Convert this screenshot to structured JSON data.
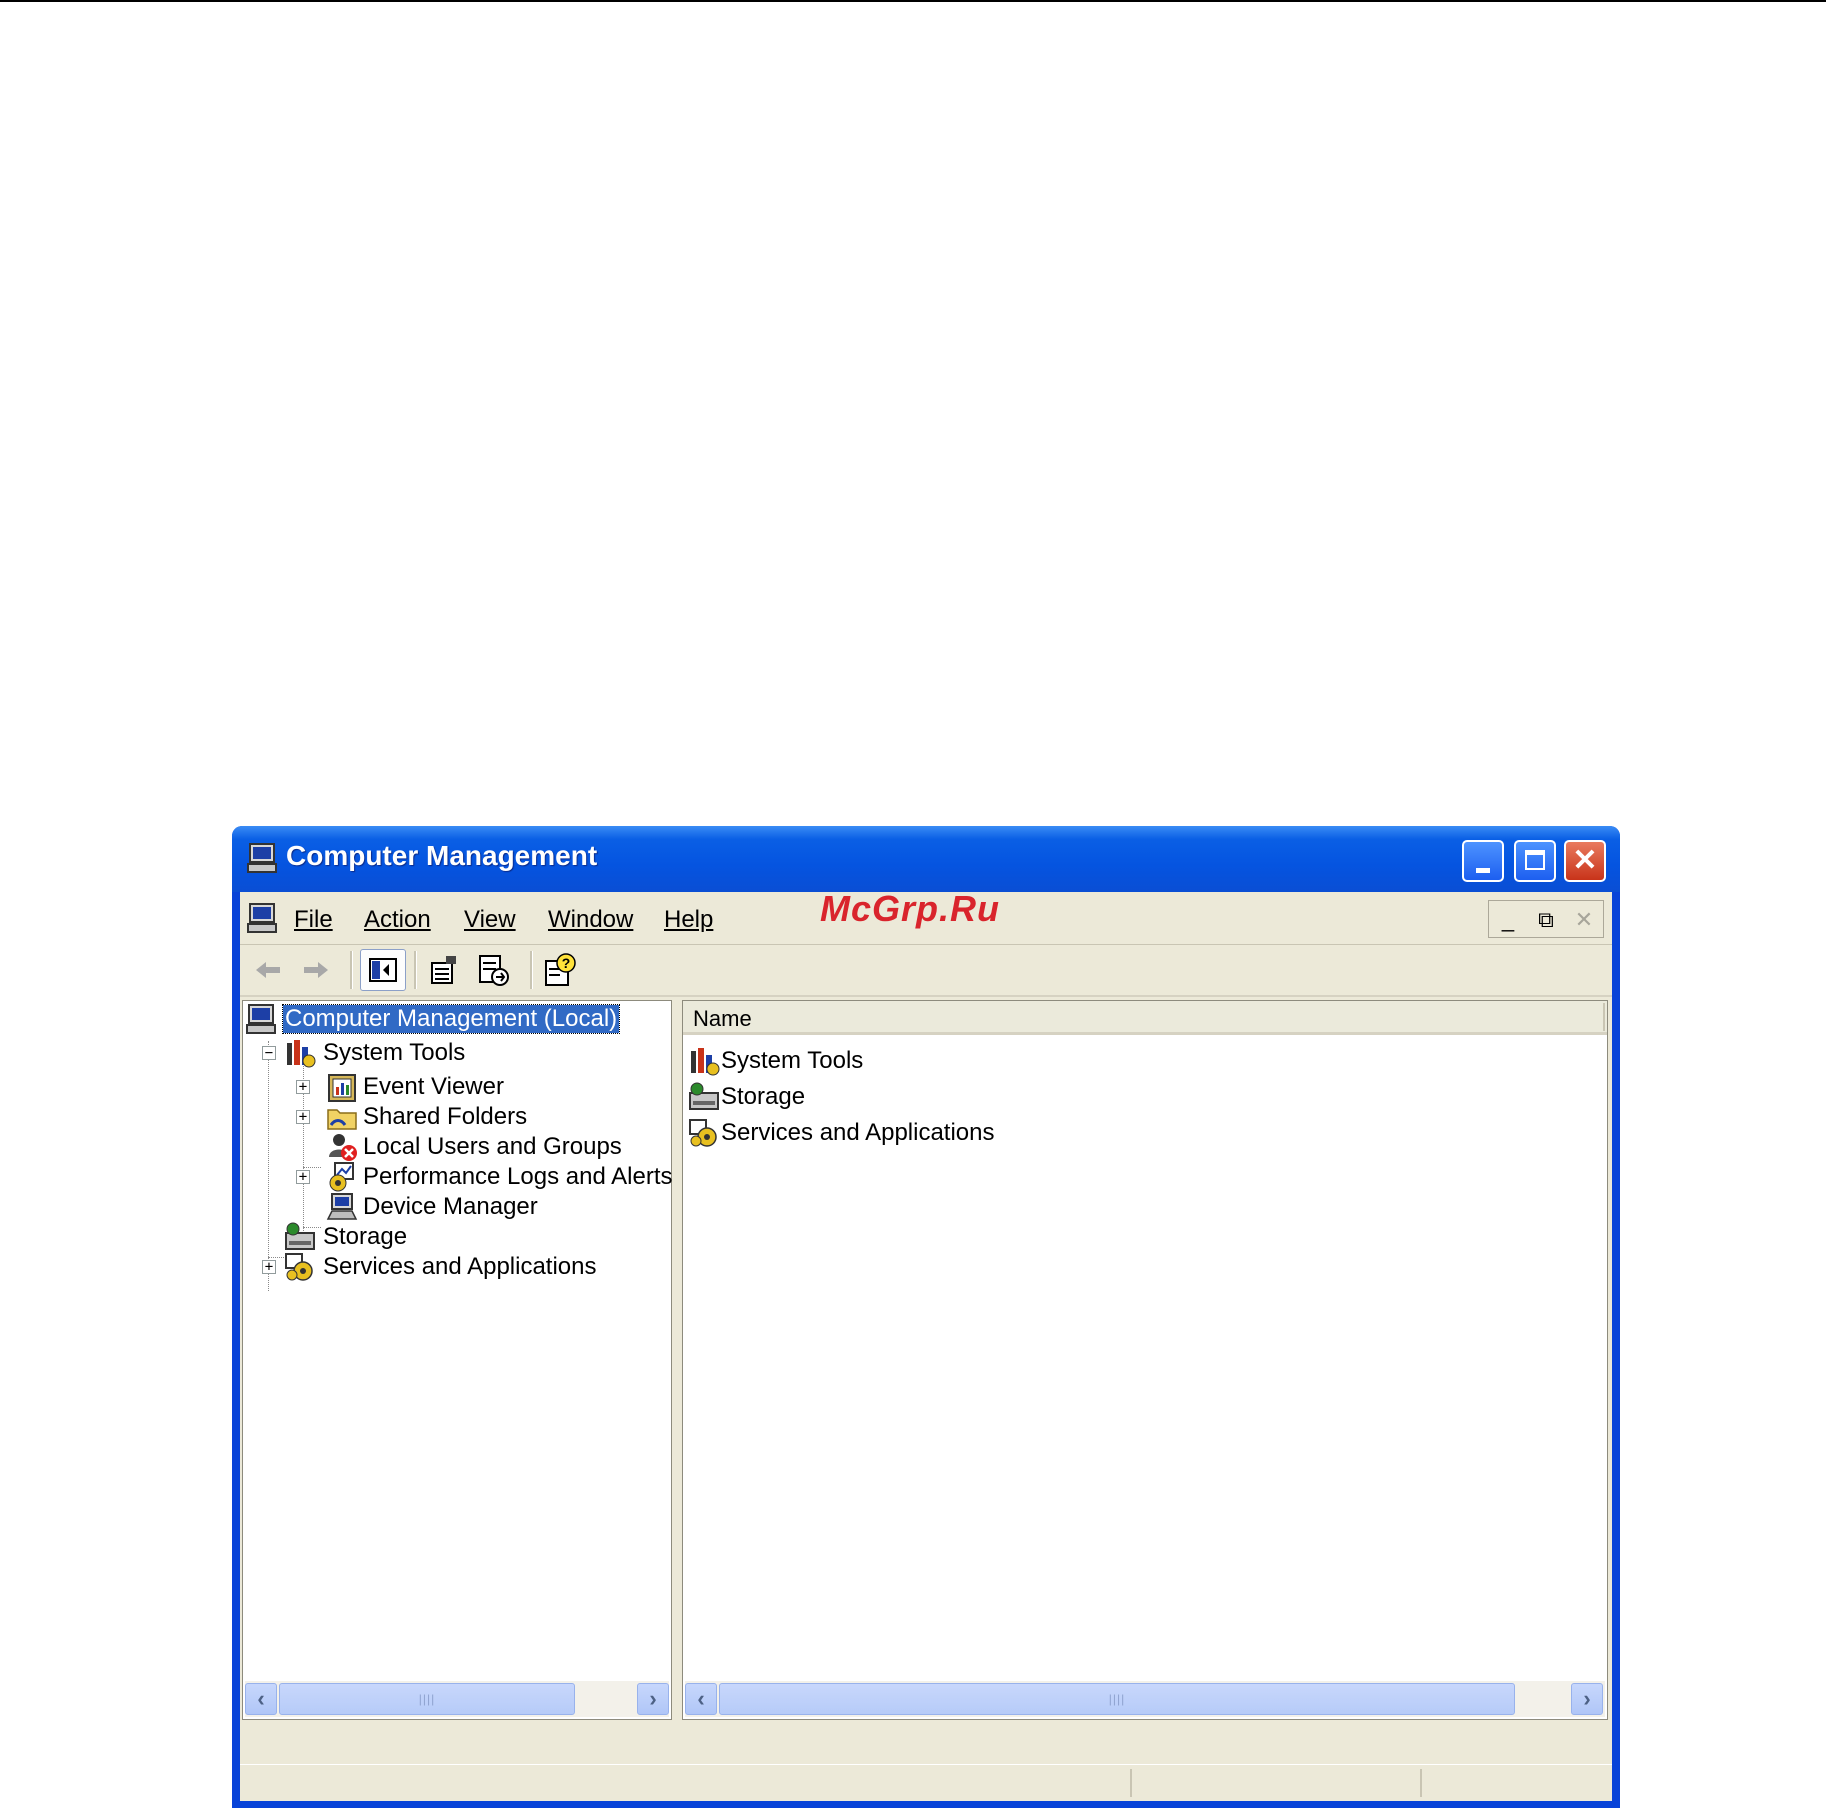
{
  "window": {
    "title": "Computer Management"
  },
  "watermark": "McGrp.Ru",
  "menu": {
    "items": [
      {
        "label": "File",
        "underline": "F"
      },
      {
        "label": "Action",
        "underline": "A"
      },
      {
        "label": "View",
        "underline": "V"
      },
      {
        "label": "Window",
        "underline": "W"
      },
      {
        "label": "Help",
        "underline": "H"
      }
    ]
  },
  "toolbar": {
    "buttons": [
      "back-icon",
      "forward-icon",
      "show-hide-tree-icon",
      "properties-icon",
      "export-list-icon",
      "help-icon"
    ]
  },
  "tree": {
    "root": "Computer Management (Local)",
    "system_tools": "System Tools",
    "event_viewer": "Event Viewer",
    "shared_folders": "Shared Folders",
    "local_users": "Local Users and Groups",
    "perf_logs": "Performance Logs and Alerts",
    "device_manager": "Device Manager",
    "storage": "Storage",
    "services": "Services and Applications"
  },
  "list": {
    "column_name": "Name",
    "items": [
      "System Tools",
      "Storage",
      "Services and Applications"
    ]
  },
  "colors": {
    "title_blue": "#0554e0",
    "selection": "#316ac5",
    "close_red": "#c8331a",
    "watermark": "#d9242c"
  }
}
